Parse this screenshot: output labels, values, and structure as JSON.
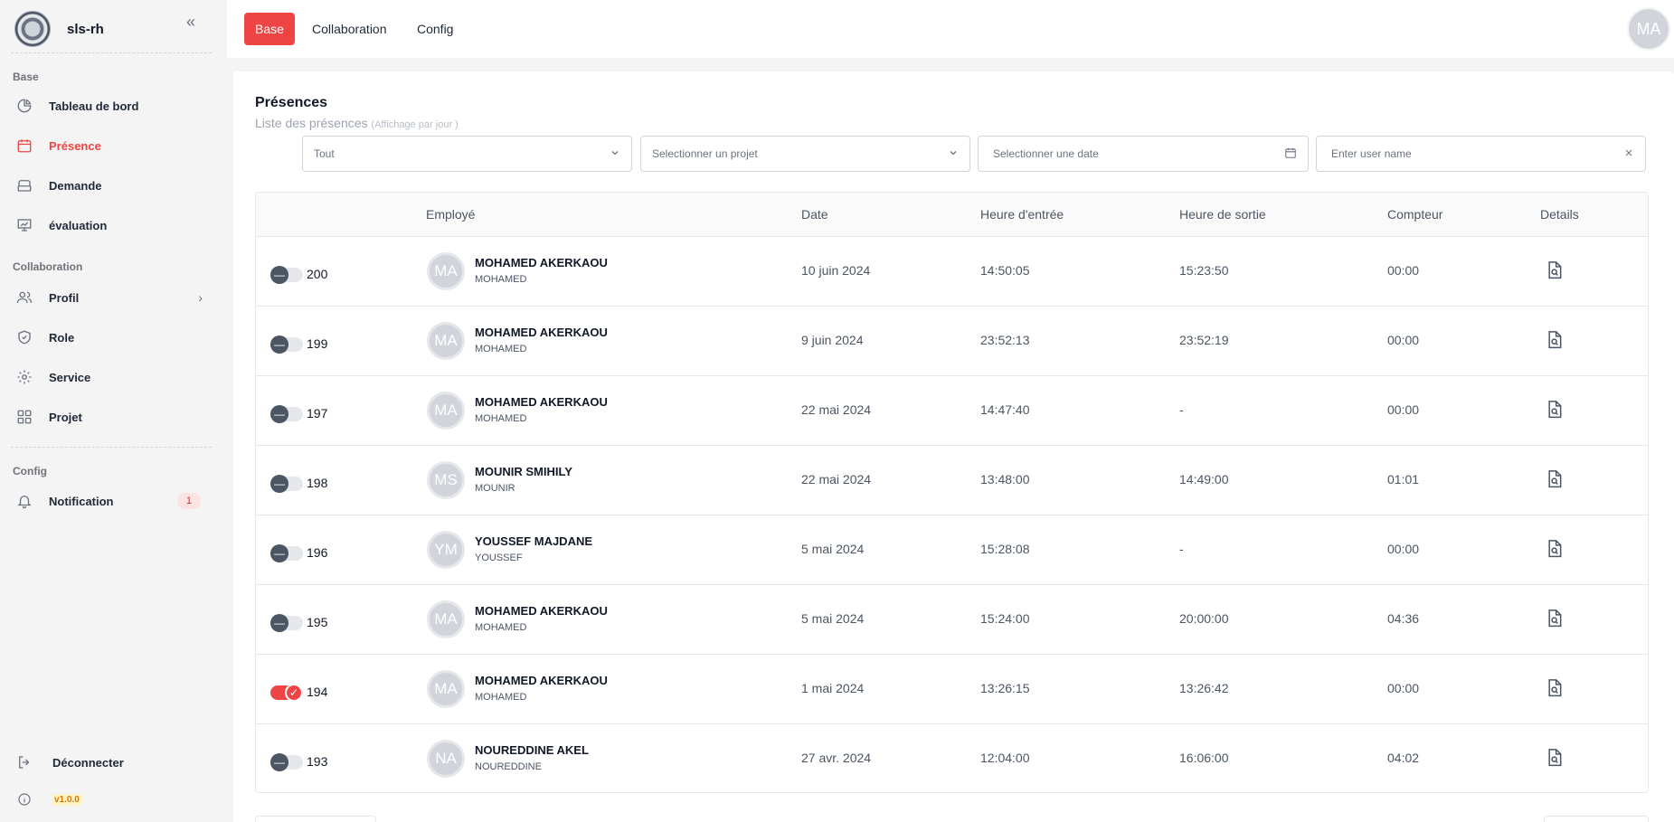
{
  "sidebar": {
    "brand": "sls-rh",
    "sections": {
      "base": "Base",
      "collaboration": "Collaboration",
      "config": "Config"
    },
    "items": [
      {
        "label": "Tableau de bord",
        "icon": "pie-chart-icon"
      },
      {
        "label": "Présence",
        "icon": "calendar-icon"
      },
      {
        "label": "Demande",
        "icon": "inbox-icon"
      },
      {
        "label": "évaluation",
        "icon": "presentation-chart-icon"
      },
      {
        "label": "Profil",
        "icon": "users-icon"
      },
      {
        "label": "Role",
        "icon": "shield-icon"
      },
      {
        "label": "Service",
        "icon": "gear-icon"
      },
      {
        "label": "Projet",
        "icon": "grid-icon"
      },
      {
        "label": "Notification",
        "icon": "bell-icon",
        "badge": "1"
      }
    ],
    "logout": "Déconnecter",
    "version": "v1.0.0"
  },
  "topbar": {
    "tabs": [
      "Base",
      "Collaboration",
      "Config"
    ],
    "active_tab": "Base",
    "avatar": "MA"
  },
  "page": {
    "title": "Présences",
    "subtitle": "Liste des présences",
    "subtitle_note": "(Affichage par jour )"
  },
  "filters": {
    "status": "Tout",
    "project_placeholder": "Selectionner un projet",
    "date_placeholder": "Selectionner une date",
    "user_placeholder": "Enter user name"
  },
  "table": {
    "headers": [
      "Employé",
      "Date",
      "Heure d'entrée",
      "Heure de sortie",
      "Compteur",
      "Details"
    ],
    "rows": [
      {
        "id": "200",
        "initials": "MA",
        "name": "MOHAMED AKERKAOU",
        "first": "MOHAMED",
        "date": "10 juin 2024",
        "in": "14:50:05",
        "out": "15:23:50",
        "counter": "00:00",
        "on": false
      },
      {
        "id": "199",
        "initials": "MA",
        "name": "MOHAMED AKERKAOU",
        "first": "MOHAMED",
        "date": "9 juin 2024",
        "in": "23:52:13",
        "out": "23:52:19",
        "counter": "00:00",
        "on": false
      },
      {
        "id": "197",
        "initials": "MA",
        "name": "MOHAMED AKERKAOU",
        "first": "MOHAMED",
        "date": "22 mai 2024",
        "in": "14:47:40",
        "out": "-",
        "counter": "00:00",
        "on": false
      },
      {
        "id": "198",
        "initials": "MS",
        "name": "MOUNIR SMIHILY",
        "first": "MOUNIR",
        "date": "22 mai 2024",
        "in": "13:48:00",
        "out": "14:49:00",
        "counter": "01:01",
        "on": false
      },
      {
        "id": "196",
        "initials": "YM",
        "name": "YOUSSEF MAJDANE",
        "first": "YOUSSEF",
        "date": "5 mai 2024",
        "in": "15:28:08",
        "out": "-",
        "counter": "00:00",
        "on": false
      },
      {
        "id": "195",
        "initials": "MA",
        "name": "MOHAMED AKERKAOU",
        "first": "MOHAMED",
        "date": "5 mai 2024",
        "in": "15:24:00",
        "out": "20:00:00",
        "counter": "04:36",
        "on": false
      },
      {
        "id": "194",
        "initials": "MA",
        "name": "MOHAMED AKERKAOU",
        "first": "MOHAMED",
        "date": "1 mai 2024",
        "in": "13:26:15",
        "out": "13:26:42",
        "counter": "00:00",
        "on": true
      },
      {
        "id": "193",
        "initials": "NA",
        "name": "NOUREDDINE AKEL",
        "first": "NOUREDDINE",
        "date": "27 avr. 2024",
        "in": "12:04:00",
        "out": "16:06:00",
        "counter": "04:02",
        "on": false
      }
    ]
  },
  "colors": {
    "accent": "#ef4444",
    "avatar_bg": "#d1d5db"
  }
}
